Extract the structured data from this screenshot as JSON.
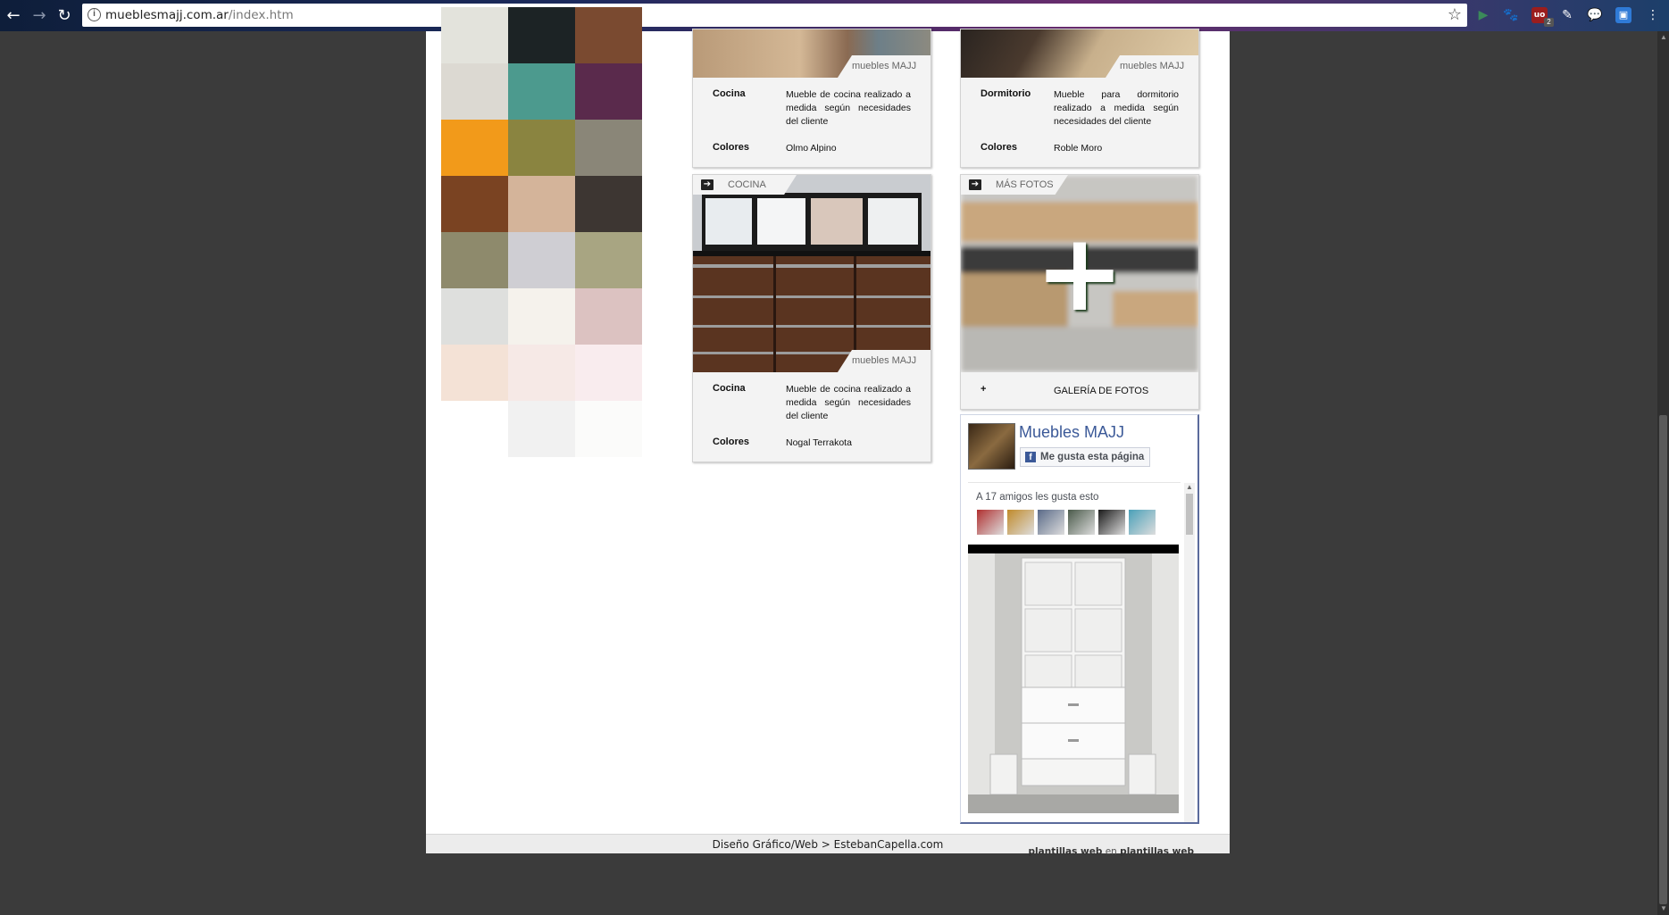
{
  "browser": {
    "url_host": "mueblesmajj.com.ar",
    "url_path": "/index.htm",
    "extension_badge": "2"
  },
  "swatches": [
    [
      "#e3e3dc",
      "#1c2325",
      "#7a4a30"
    ],
    [
      "#dcd9d2",
      "#4c9a8e",
      "#5a2a4c"
    ],
    [
      "#f29a1a",
      "#8a8440",
      "#8a8678"
    ],
    [
      "#7a4322",
      "#d4b49a",
      "#3d3632"
    ],
    [
      "#8e8a6c",
      "#cfced3",
      "#a8a582"
    ],
    [
      "#dedfdd",
      "#f5f2ec",
      "#dcc2c1"
    ],
    [
      "#f4e2d6",
      "#f6e9e6",
      "#f9ecee"
    ],
    [
      "",
      "#f1f1f1",
      "#fbfbfa"
    ]
  ],
  "cards": [
    {
      "brand": "muebles MAJJ",
      "type_key": "Cocina",
      "description": "Mueble de cocina realizado a medida según necesidades del cliente",
      "colors_key": "Colores",
      "colors_value": "Olmo Alpino"
    },
    {
      "brand": "muebles MAJJ",
      "type_key": "Dormitorio",
      "description": "Mueble para dormitorio realizado a medida según necesidades del cliente",
      "colors_key": "Colores",
      "colors_value": "Roble Moro"
    },
    {
      "tab": "COCINA",
      "brand": "muebles MAJJ",
      "type_key": "Cocina",
      "description": "Mueble de cocina realizado a medida según necesidades del cliente",
      "colors_key": "Colores",
      "colors_value": "Nogal Terrakota"
    },
    {
      "tab": "MÁS FOTOS",
      "plus": "+",
      "gallery": "GALERÍA DE FOTOS"
    }
  ],
  "facebook": {
    "page_name": "Muebles MAJJ",
    "like_button": "Me gusta esta página",
    "friends_text": "A 17 amigos les gusta esto"
  },
  "footer": {
    "credit": "Diseño Gráfico/Web > EstebanCapella.com",
    "tpl_a": "plantillas web",
    "tpl_mid": "en",
    "tpl_b": "plantillas web"
  }
}
